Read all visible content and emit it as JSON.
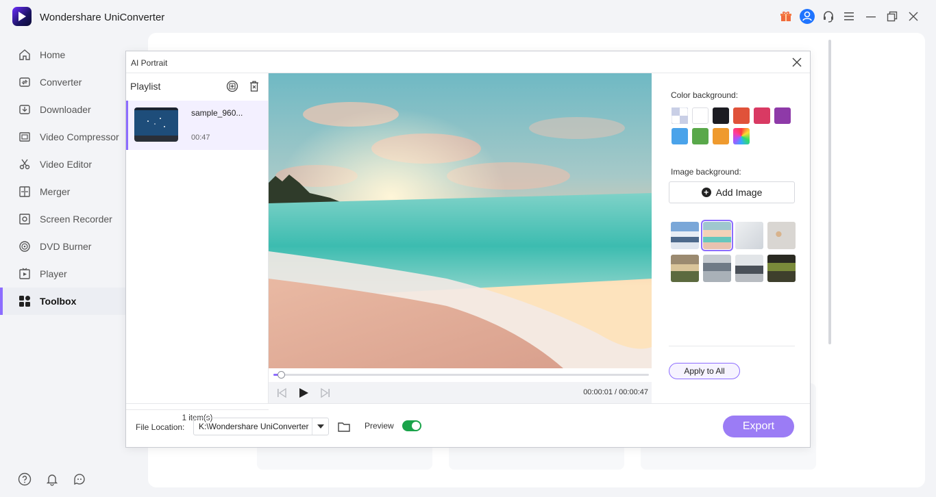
{
  "app": {
    "title": "Wondershare UniConverter"
  },
  "sidebar": {
    "items": [
      {
        "label": "Home",
        "icon": "home-icon"
      },
      {
        "label": "Converter",
        "icon": "converter-icon"
      },
      {
        "label": "Downloader",
        "icon": "downloader-icon"
      },
      {
        "label": "Video Compressor",
        "icon": "compress-icon"
      },
      {
        "label": "Video Editor",
        "icon": "scissors-icon"
      },
      {
        "label": "Merger",
        "icon": "merge-icon"
      },
      {
        "label": "Screen Recorder",
        "icon": "record-icon"
      },
      {
        "label": "DVD Burner",
        "icon": "disc-icon"
      },
      {
        "label": "Player",
        "icon": "play-icon"
      },
      {
        "label": "Toolbox",
        "icon": "grid-icon",
        "active": true
      }
    ]
  },
  "dialog": {
    "title": "AI Portrait",
    "playlist": {
      "heading": "Playlist",
      "items": [
        {
          "name": "sample_960...",
          "duration": "00:47"
        }
      ],
      "count": "1 item(s)"
    },
    "player": {
      "time": "00:00:01 / 00:00:47",
      "progress": 0.02
    },
    "settings": {
      "color_bg_label": "Color background:",
      "colors": [
        "transparent",
        "#ffffff",
        "#1c1c22",
        "#e0523a",
        "#d93a63",
        "#8e3aa8",
        "#4aa3ea",
        "#59a84a",
        "#ef9a2e",
        "rainbow"
      ],
      "image_bg_label": "Image background:",
      "add_image_label": "Add Image",
      "apply_label": "Apply to All"
    },
    "footer": {
      "file_location_label": "File Location:",
      "file_location_value": "K:\\Wondershare UniConverter",
      "preview_label": "Preview",
      "preview_on": true,
      "export_label": "Export"
    }
  },
  "colors": {
    "accent": "#8c6cff",
    "export": "#9b7cf5",
    "toggle_on": "#1aa34a"
  }
}
